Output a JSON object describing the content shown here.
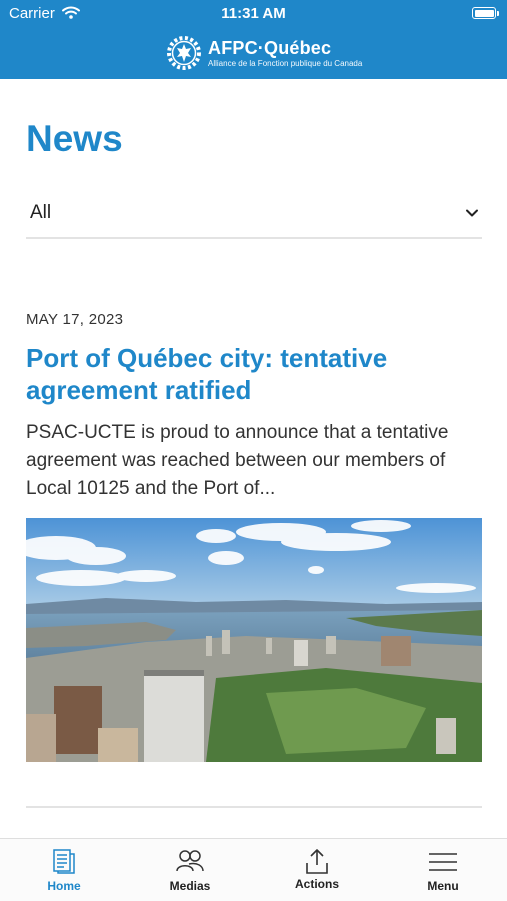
{
  "status_bar": {
    "carrier": "Carrier",
    "time": "11:31 AM"
  },
  "header": {
    "logo_title": "AFPC·Québec",
    "logo_subtitle": "Alliance de la Fonction publique du Canada"
  },
  "page": {
    "title": "News"
  },
  "filter": {
    "selected": "All"
  },
  "article": {
    "date": "MAY 17, 2023",
    "title": "Port of Québec city: tentative agreement ratified",
    "excerpt": "PSAC-UCTE is proud to announce that a tentative agreement was reached between our members of Local 10125 and the Port of..."
  },
  "tabbar": {
    "tabs": [
      {
        "label": "Home",
        "icon": "document-icon",
        "active": true
      },
      {
        "label": "Medias",
        "icon": "people-icon",
        "active": false
      },
      {
        "label": "Actions",
        "icon": "share-icon",
        "active": false
      },
      {
        "label": "Menu",
        "icon": "hamburger-icon",
        "active": false
      }
    ]
  },
  "colors": {
    "brand": "#1f87c9",
    "divider": "#e3e3e3",
    "text": "#333333"
  }
}
